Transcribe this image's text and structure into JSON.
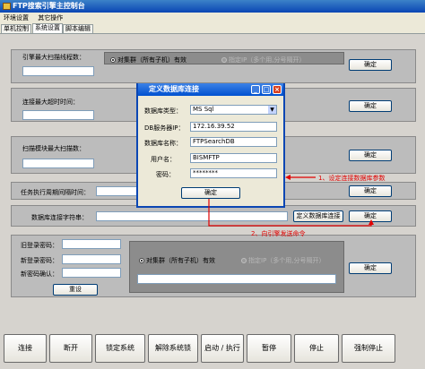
{
  "window": {
    "title": "FTP搜索引擎主控制台"
  },
  "menu": [
    "环境设置",
    "其它操作"
  ],
  "tabs": [
    "单机控制",
    "系统设置",
    "脚本编辑"
  ],
  "settings": {
    "max_scan_threads_label": "引擎最大扫描线程数：",
    "connect_timeout_label": "连接最大超时时间：",
    "max_scan_blocks_label": "扫描模块最大扫描数：",
    "task_interval_label": "任务执行周期间隔时间：",
    "db_conn_label": "数据库连接字符串：",
    "define_db_conn_button": "定义数据库连接",
    "confirm_label": "确定",
    "radio_all": "对集群（所有子机）有效",
    "radio_single": "指定IP（多个用,分号隔开）"
  },
  "password": {
    "old_label": "旧登录密码：",
    "new_label": "新登录密码：",
    "confirm_label": "新密码确认：",
    "reset_button": "重设"
  },
  "bottom_buttons": [
    "连接",
    "断开",
    "锁定系统",
    "解除系统锁",
    "启动 / 执行",
    "暂停",
    "停止",
    "强制停止"
  ],
  "dialog": {
    "title": "定义数据库连接",
    "db_type_label": "数据库类型：",
    "db_type_value": "MS Sql",
    "server_ip_label": "DB服务器IP：",
    "server_ip_value": "172.16.39.52",
    "db_name_label": "数据库名称：",
    "db_name_value": "FTPSearchDB",
    "username_label": "用户名：",
    "username_value": "BISMFTP",
    "password_label": "密码：",
    "password_value": "********",
    "confirm_button": "确定"
  },
  "annotations": {
    "step1": "1、设定连接数据库参数",
    "step2": "2、向引擎发送命令"
  },
  "colors": {
    "annotation": "#e00000",
    "titlebar": "#0a46b4"
  }
}
